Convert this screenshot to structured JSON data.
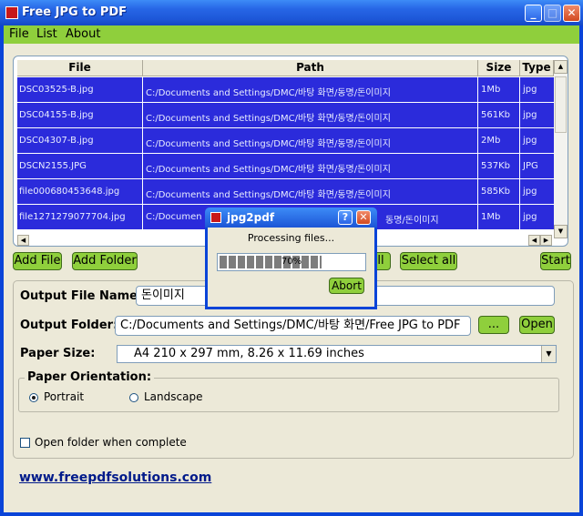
{
  "app": {
    "title": "Free JPG to PDF"
  },
  "menu": [
    "File",
    "List",
    "About"
  ],
  "table": {
    "headers": [
      "File",
      "Path",
      "Size",
      "Type"
    ],
    "rows": [
      {
        "file": "DSC03525-B.jpg",
        "path": "C:/Documents and Settings/DMC/바탕 화면/동명/돈이미지",
        "size": "1Mb",
        "type": "jpg"
      },
      {
        "file": "DSC04155-B.jpg",
        "path": "C:/Documents and Settings/DMC/바탕 화면/동명/돈이미지",
        "size": "561Kb",
        "type": "jpg"
      },
      {
        "file": "DSC04307-B.jpg",
        "path": "C:/Documents and Settings/DMC/바탕 화면/동명/돈이미지",
        "size": "2Mb",
        "type": "jpg"
      },
      {
        "file": "DSCN2155.JPG",
        "path": "C:/Documents and Settings/DMC/바탕 화면/동명/돈이미지",
        "size": "537Kb",
        "type": "JPG"
      },
      {
        "file": "file000680453648.jpg",
        "path": "C:/Documents and Settings/DMC/바탕 화면/동명/돈이미지",
        "size": "585Kb",
        "type": "jpg"
      },
      {
        "file": "file1271279077704.jpg",
        "path": "C:/Documen",
        "path_tail": "동명/돈이미지",
        "size": "1Mb",
        "type": "jpg"
      }
    ]
  },
  "buttons": {
    "add_file": "Add File",
    "add_folder": "Add Folder",
    "clear_all_partial": "all",
    "select_all": "Select all",
    "start": "Start",
    "browse": "...",
    "open": "Open"
  },
  "form": {
    "output_file_label": "Output File Name:",
    "output_file_value": "돈이미지",
    "output_folder_label": "Output Folder:",
    "output_folder_value": "C:/Documents and Settings/DMC/바탕 화면/Free JPG to PDF",
    "paper_size_label": "Paper Size:",
    "paper_size_value": "A4 210 x 297 mm, 8.26 x 11.69 inches",
    "orientation_label": "Paper Orientation:",
    "orientation_options": [
      "Portrait",
      "Landscape"
    ],
    "orientation_selected": "Portrait",
    "open_folder_label": "Open folder when complete",
    "open_folder_checked": false
  },
  "footer": {
    "link": "www.freepdfsolutions.com"
  },
  "dialog": {
    "title": "jpg2pdf",
    "message": "Processing files...",
    "progress_percent": 70,
    "progress_label": "70%",
    "abort_label": "Abort"
  },
  "colors": {
    "accent_green": "#8fcf3c",
    "selection_blue": "#2b2bdb",
    "title_blue": "#2766e6"
  }
}
